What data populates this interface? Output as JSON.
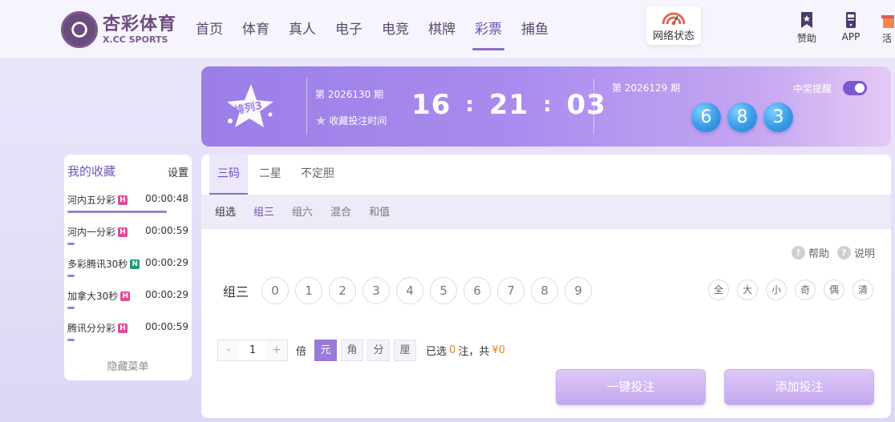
{
  "brand": {
    "name_cn": "杏彩体育",
    "name_en": "X.CC SPORTS"
  },
  "nav": [
    {
      "label": "首页"
    },
    {
      "label": "体育"
    },
    {
      "label": "真人"
    },
    {
      "label": "电子"
    },
    {
      "label": "电竞"
    },
    {
      "label": "棋牌"
    },
    {
      "label": "彩票",
      "active": true
    },
    {
      "label": "捕鱼"
    }
  ],
  "header": {
    "network_status": "网络状态",
    "sponsor": "赞助",
    "app": "APP",
    "activity": "活"
  },
  "banner": {
    "lottery_name": "排列3",
    "current_issue": "第 2026130 期",
    "fav_label": "收藏投注时间",
    "countdown": {
      "h": "16",
      "m": "21",
      "s": "03"
    },
    "prev_issue": "第 2026129 期",
    "prev_numbers": [
      "6",
      "8",
      "3"
    ],
    "notify_label": "中奖提醒",
    "notify_on": true
  },
  "sidebar": {
    "title": "我的收藏",
    "settings": "设置",
    "items": [
      {
        "name": "河内五分彩",
        "badge": "H",
        "time": "00:00:48",
        "progress": 0.82
      },
      {
        "name": "河内一分彩",
        "badge": "H",
        "time": "00:00:59",
        "progress": 0.06
      },
      {
        "name": "多彩腾讯30秒",
        "badge": "N",
        "time": "00:00:29",
        "progress": 0.06
      },
      {
        "name": "加拿大30秒",
        "badge": "H",
        "time": "00:00:29",
        "progress": 0.06
      },
      {
        "name": "腾讯分分彩",
        "badge": "H",
        "time": "00:00:59",
        "progress": 0.06
      }
    ],
    "hide_menu": "隐藏菜单"
  },
  "main": {
    "tabs": [
      {
        "label": "三码",
        "active": true
      },
      {
        "label": "二星"
      },
      {
        "label": "不定胆"
      }
    ],
    "subtabs": [
      {
        "label": "组选",
        "state": "active"
      },
      {
        "label": "组三",
        "state": "hl"
      },
      {
        "label": "组六"
      },
      {
        "label": "混合"
      },
      {
        "label": "和值"
      }
    ],
    "help": "帮助",
    "explain": "说明",
    "row_label": "组三",
    "digits": [
      "0",
      "1",
      "2",
      "3",
      "4",
      "5",
      "6",
      "7",
      "8",
      "9"
    ],
    "quick": [
      "全",
      "大",
      "小",
      "奇",
      "偶",
      "清"
    ],
    "multiplier": {
      "minus": "-",
      "value": "1",
      "plus": "+",
      "label": "倍"
    },
    "units": [
      {
        "label": "元",
        "active": true
      },
      {
        "label": "角"
      },
      {
        "label": "分"
      },
      {
        "label": "厘"
      }
    ],
    "summary": {
      "prefix": "已选",
      "count": "0",
      "mid": "注，共",
      "amount": "¥0"
    },
    "btn_quick": "一键投注",
    "btn_add": "添加投注"
  },
  "colors": {
    "accent": "#8b6cc4",
    "ball": "#3a9ae8",
    "badge_h": "#e04a9a",
    "badge_n": "#1e9a6e"
  }
}
